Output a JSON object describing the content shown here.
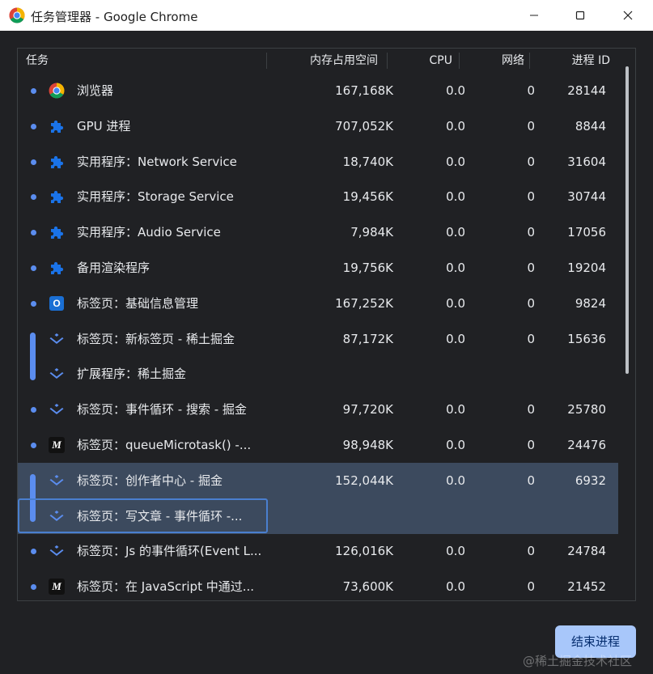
{
  "window": {
    "title": "任务管理器 - Google Chrome"
  },
  "columns": {
    "task": "任务",
    "memory": "内存占用空间",
    "cpu": "CPU",
    "network": "网络",
    "pid": "进程 ID"
  },
  "rows": [
    {
      "icon": "chrome-logo-icon",
      "task": "浏览器",
      "memory": "167,168K",
      "cpu": "0.0",
      "network": "0",
      "pid": "28144"
    },
    {
      "icon": "puzzle-icon",
      "task": "GPU 进程",
      "memory": "707,052K",
      "cpu": "0.0",
      "network": "0",
      "pid": "8844"
    },
    {
      "icon": "puzzle-icon",
      "task": "实用程序：Network Service",
      "memory": "18,740K",
      "cpu": "0.0",
      "network": "0",
      "pid": "31604"
    },
    {
      "icon": "puzzle-icon",
      "task": "实用程序：Storage Service",
      "memory": "19,456K",
      "cpu": "0.0",
      "network": "0",
      "pid": "30744"
    },
    {
      "icon": "puzzle-icon",
      "task": "实用程序：Audio Service",
      "memory": "7,984K",
      "cpu": "0.0",
      "network": "0",
      "pid": "17056"
    },
    {
      "icon": "puzzle-icon",
      "task": "备用渲染程序",
      "memory": "19,756K",
      "cpu": "0.0",
      "network": "0",
      "pid": "19204"
    },
    {
      "icon": "outlook-o-icon",
      "task": "标签页：基础信息管理",
      "memory": "167,252K",
      "cpu": "0.0",
      "network": "0",
      "pid": "9824"
    },
    {
      "icon": "juejin-logo-icon",
      "task": "标签页：新标签页 - 稀土掘金",
      "memory": "87,172K",
      "cpu": "0.0",
      "network": "0",
      "pid": "15636"
    },
    {
      "icon": "juejin-logo-icon",
      "task": "扩展程序：稀土掘金",
      "memory": "",
      "cpu": "",
      "network": "",
      "pid": ""
    },
    {
      "icon": "juejin-logo-icon",
      "task": "标签页：事件循环 - 搜索 - 掘金",
      "memory": "97,720K",
      "cpu": "0.0",
      "network": "0",
      "pid": "25780"
    },
    {
      "icon": "m-logo-icon",
      "task": "标签页：queueMicrotask() -...",
      "memory": "98,948K",
      "cpu": "0.0",
      "network": "0",
      "pid": "24476"
    },
    {
      "icon": "juejin-logo-icon",
      "task": "标签页：创作者中心 - 掘金",
      "memory": "152,044K",
      "cpu": "0.0",
      "network": "0",
      "pid": "6932"
    },
    {
      "icon": "juejin-logo-icon",
      "task": "标签页：写文章 - 事件循环 -...",
      "memory": "",
      "cpu": "",
      "network": "",
      "pid": ""
    },
    {
      "icon": "juejin-logo-icon",
      "task": "标签页：Js 的事件循环(Event L...",
      "memory": "126,016K",
      "cpu": "0.0",
      "network": "0",
      "pid": "24784"
    },
    {
      "icon": "m-logo-icon",
      "task": "标签页：在 JavaScript 中通过...",
      "memory": "73,600K",
      "cpu": "0.0",
      "network": "0",
      "pid": "21452"
    }
  ],
  "end_process_button": "结束进程",
  "watermark": "@稀土掘金技术社区",
  "colors": {
    "accent": "#5b8def",
    "selected_row": "#3c4a5e",
    "button_bg": "#a8c7fa"
  }
}
